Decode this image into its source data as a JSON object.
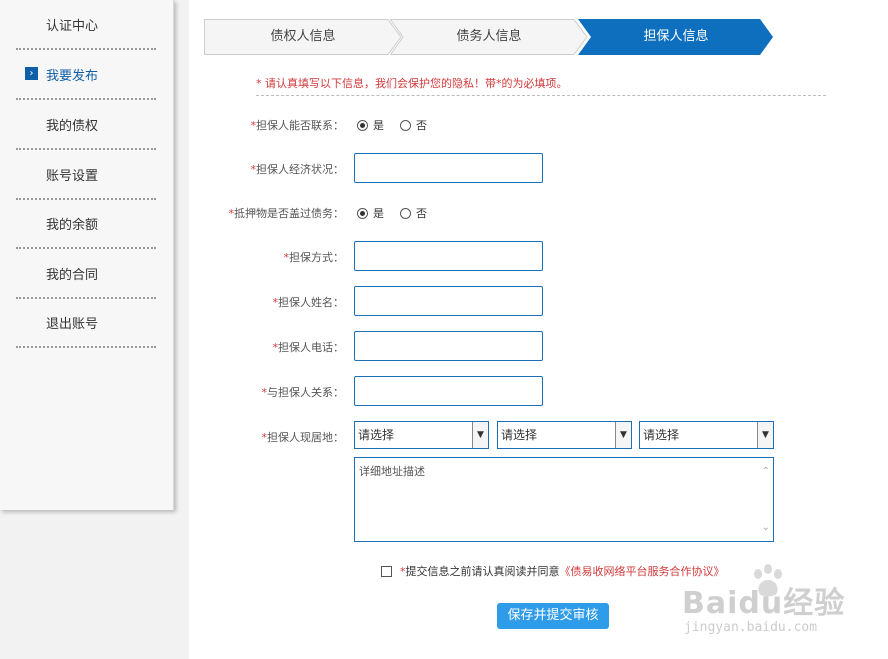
{
  "sidebar": {
    "items": [
      {
        "label": "认证中心",
        "active": false
      },
      {
        "label": "我要发布",
        "active": true
      },
      {
        "label": "我的债权",
        "active": false
      },
      {
        "label": "账号设置",
        "active": false
      },
      {
        "label": "我的余额",
        "active": false
      },
      {
        "label": "我的合同",
        "active": false
      },
      {
        "label": "退出账号",
        "active": false
      }
    ],
    "chevron_icon": "›"
  },
  "steps": [
    {
      "label": "债权人信息"
    },
    {
      "label": "债务人信息"
    },
    {
      "label": "担保人信息"
    }
  ],
  "notice": "* 请认真填写以下信息，我们会保护您的隐私！带*的为必填项。",
  "form": {
    "guarantor_contactable": {
      "label": "担保人能否联系：",
      "opt_yes": "是",
      "opt_no": "否",
      "selected": "是"
    },
    "guarantor_economy": {
      "label": "担保人经济状况："
    },
    "collateral_debt": {
      "label": "抵押物是否盖过债务：",
      "opt_yes": "是",
      "opt_no": "否",
      "selected": "是"
    },
    "guarantee_method": {
      "label": "担保方式："
    },
    "guarantor_name": {
      "label": "担保人姓名："
    },
    "guarantor_phone": {
      "label": "担保人电话："
    },
    "relationship": {
      "label": "与担保人关系："
    },
    "residence": {
      "label": "担保人现居地：",
      "select_1": "请选择",
      "select_2": "请选择",
      "select_3": "请选择",
      "address_placeholder": "详细地址描述"
    },
    "star": "*"
  },
  "agreement": {
    "text": "提交信息之前请认真阅读并同意",
    "link": "《债易收网络平台服务合作协议》"
  },
  "submit_label": "保存并提交审核",
  "watermark": {
    "brand": "Baidu经验",
    "url": "jingyan.baidu.com"
  },
  "colors": {
    "active_step": "#0e6fbf",
    "accent": "#2f9ce9",
    "required": "#d23a3a"
  }
}
